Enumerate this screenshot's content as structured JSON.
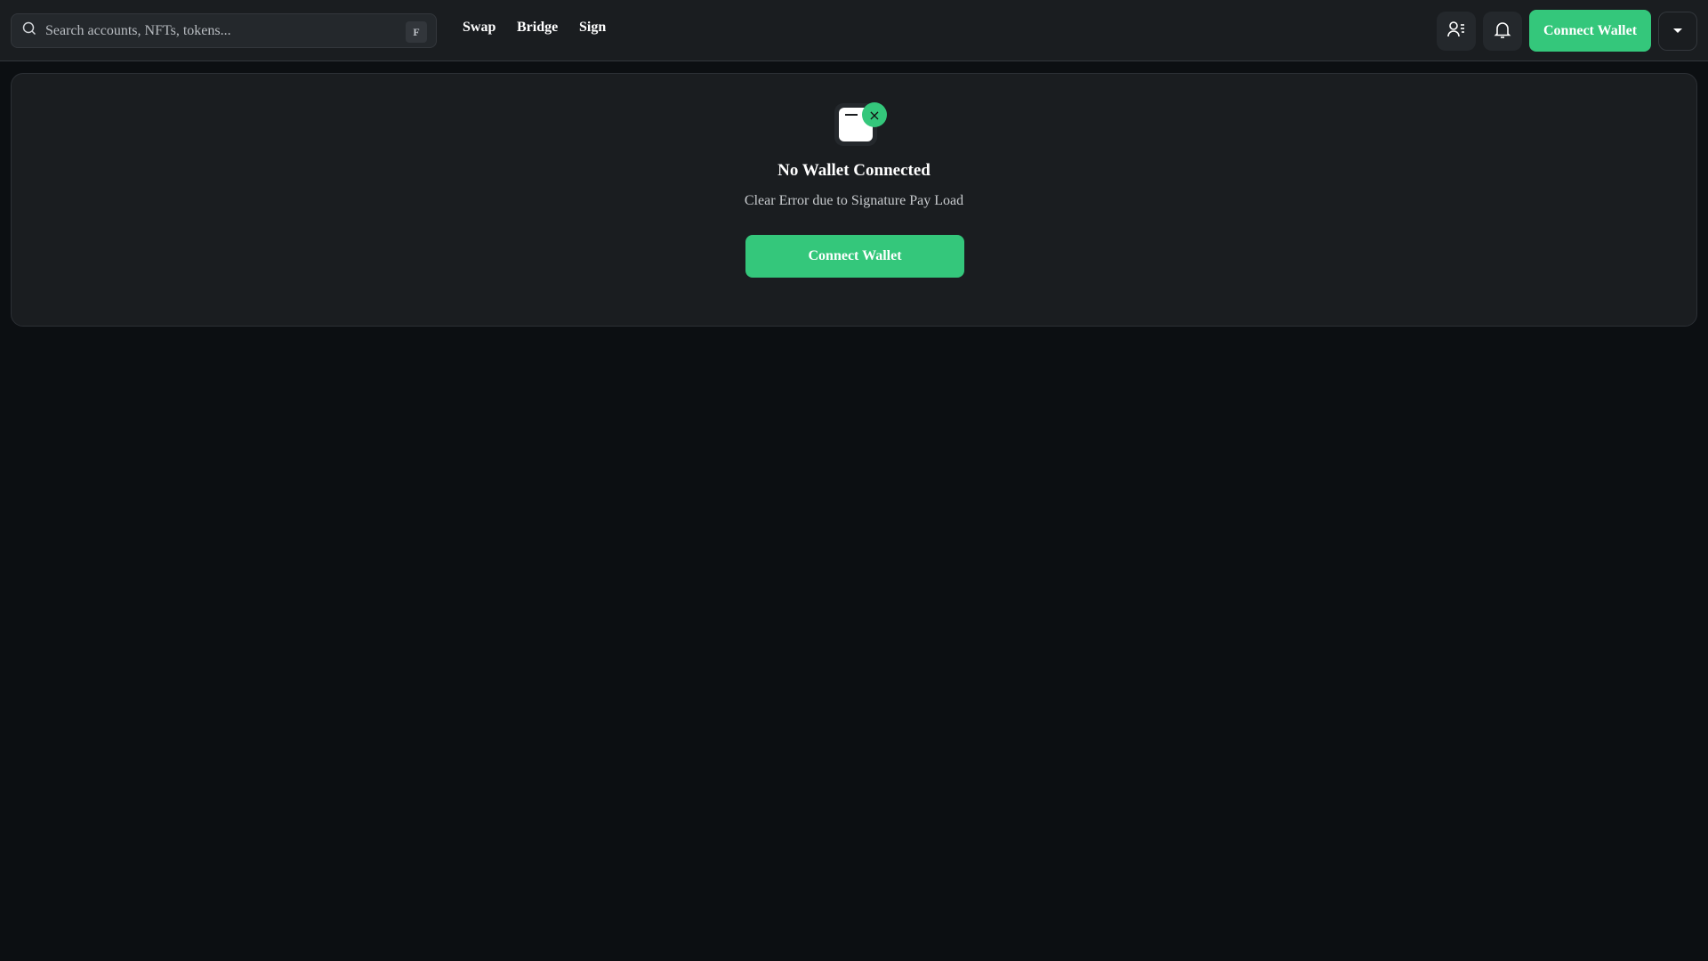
{
  "header": {
    "search": {
      "placeholder": "Search accounts, NFTs, tokens...",
      "shortcut": "F"
    },
    "nav": [
      {
        "label": "Swap"
      },
      {
        "label": "Bridge"
      },
      {
        "label": "Sign"
      }
    ],
    "connect_label": "Connect Wallet"
  },
  "main": {
    "title": "No Wallet Connected",
    "subtitle": "Clear Error due to Signature Pay Load",
    "connect_label": "Connect Wallet",
    "badge_icon": "×"
  },
  "colors": {
    "accent": "#34c77b",
    "background": "#0c0f12",
    "surface": "#1a1d20"
  }
}
